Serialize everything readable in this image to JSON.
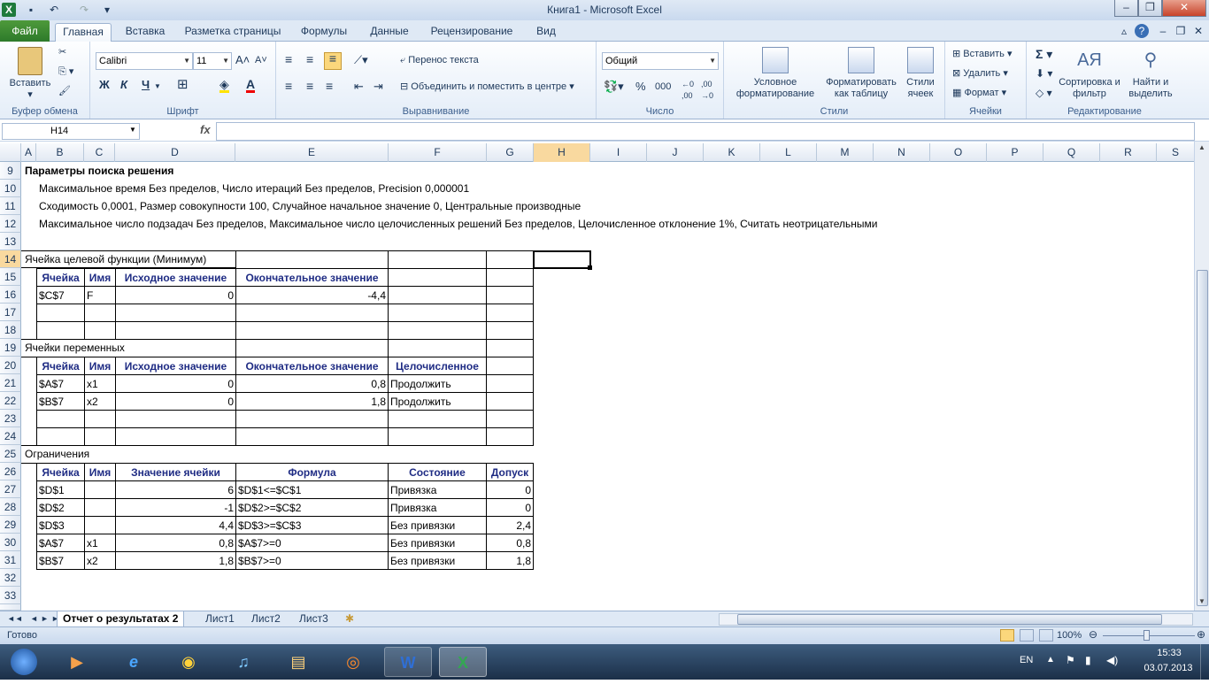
{
  "window": {
    "title": "Книга1  -  Microsoft Excel"
  },
  "ribbon_tabs": [
    "Файл",
    "Главная",
    "Вставка",
    "Разметка страницы",
    "Формулы",
    "Данные",
    "Рецензирование",
    "Вид"
  ],
  "ribbon": {
    "clipboard": {
      "paste": "Вставить",
      "label": "Буфер обмена"
    },
    "font": {
      "name": "Calibri",
      "size": "11",
      "bold": "Ж",
      "italic": "К",
      "underline": "Ч",
      "label": "Шрифт"
    },
    "alignment": {
      "wrap": "Перенос текста",
      "merge": "Объединить и поместить в центре",
      "label": "Выравнивание"
    },
    "number": {
      "format": "Общий",
      "percent": "%",
      "thousands": "000",
      "label": "Число"
    },
    "styles": {
      "conditional": "Условное форматирование",
      "as_table": "Форматировать как таблицу",
      "cell_styles": "Стили ячеек",
      "label": "Стили"
    },
    "cells": {
      "insert": "Вставить",
      "delete": "Удалить",
      "format": "Формат",
      "label": "Ячейки"
    },
    "editing": {
      "sort": "Сортировка и фильтр",
      "find": "Найти и выделить",
      "label": "Редактирование"
    }
  },
  "formula_bar": {
    "name_box": "H14",
    "fx": "fx",
    "value": ""
  },
  "columns": [
    "A",
    "B",
    "C",
    "D",
    "E",
    "F",
    "G",
    "H",
    "I",
    "J",
    "K",
    "L",
    "M",
    "N",
    "O",
    "P",
    "Q",
    "R",
    "S"
  ],
  "rows": [
    "9",
    "10",
    "11",
    "12",
    "13",
    "14",
    "15",
    "16",
    "17",
    "18",
    "19",
    "20",
    "21",
    "22",
    "23",
    "24",
    "25",
    "26",
    "27",
    "28",
    "29",
    "30",
    "31",
    "32",
    "33"
  ],
  "text": {
    "r9": "Параметры поиска решения",
    "r10": "Максимальное время Без пределов,  Число итераций Без пределов, Precision 0,000001",
    "r11": " Сходимость 0,0001, Размер совокупности 100, Случайное начальное значение 0, Центральные производные",
    "r12": "Максимальное число подзадач Без пределов, Максимальное число целочисленных решений Без пределов, Целочисленное отклонение 1%, Считать неотрицательными",
    "r14": "Ячейка целевой функции (Минимум)",
    "r19": "Ячейки переменных",
    "r25": "Ограничения"
  },
  "objective": {
    "headers": [
      "Ячейка",
      "Имя",
      "Исходное значение",
      "Окончательное значение"
    ],
    "row": [
      "$C$7",
      "F",
      "0",
      "-4,4"
    ]
  },
  "variables": {
    "headers": [
      "Ячейка",
      "Имя",
      "Исходное значение",
      "Окончательное значение",
      "Целочисленное"
    ],
    "rows": [
      [
        "$A$7",
        "x1",
        "0",
        "0,8",
        "Продолжить"
      ],
      [
        "$B$7",
        "x2",
        "0",
        "1,8",
        "Продолжить"
      ]
    ]
  },
  "constraints": {
    "headers": [
      "Ячейка",
      "Имя",
      "Значение ячейки",
      "Формула",
      "Состояние",
      "Допуск"
    ],
    "rows": [
      [
        "$D$1",
        "",
        "6",
        "$D$1<=$C$1",
        "Привязка",
        "0"
      ],
      [
        "$D$2",
        "",
        "-1",
        "$D$2>=$C$2",
        "Привязка",
        "0"
      ],
      [
        "$D$3",
        "",
        "4,4",
        "$D$3>=$C$3",
        "Без привязки",
        "2,4"
      ],
      [
        "$A$7",
        "x1",
        "0,8",
        "$A$7>=0",
        "Без привязки",
        "0,8"
      ],
      [
        "$B$7",
        "x2",
        "1,8",
        "$B$7>=0",
        "Без привязки",
        "1,8"
      ]
    ]
  },
  "sheets": [
    "Отчет о результатах 2",
    "Лист1",
    "Лист2",
    "Лист3"
  ],
  "status": {
    "ready": "Готово",
    "zoom": "100%"
  },
  "taskbar": {
    "lang": "EN",
    "time": "15:33",
    "date": "03.07.2013"
  }
}
